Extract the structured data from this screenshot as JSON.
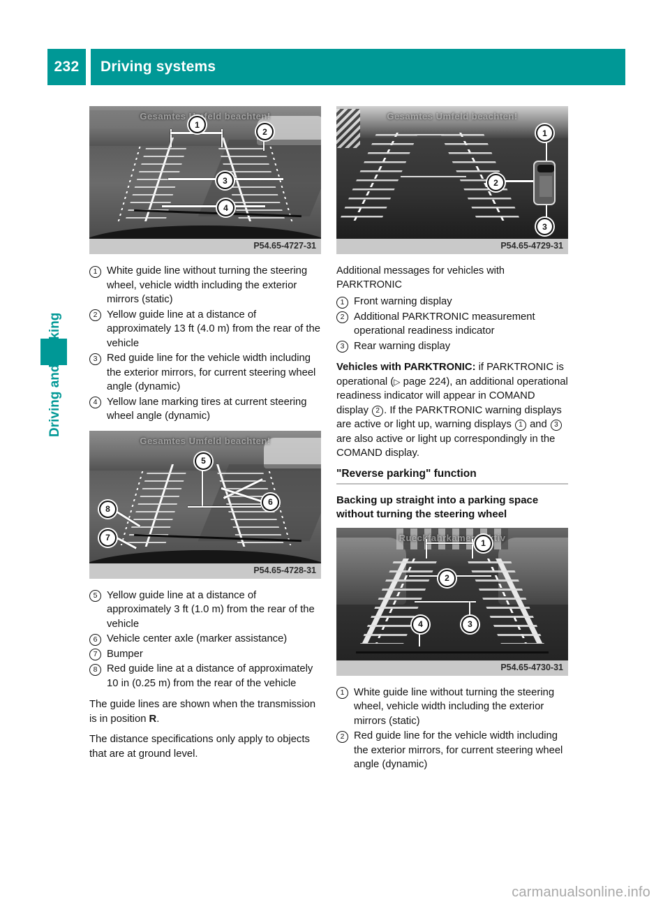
{
  "header": {
    "page_number": "232",
    "title": "Driving systems"
  },
  "sidebar": {
    "tab_label": "Driving and parking",
    "marker_color": "#009896"
  },
  "theme": {
    "accent": "#009896",
    "caption_bar": "#c9c9c9",
    "rule": "#bdbdbd"
  },
  "left_column": {
    "figure_1": {
      "caption": "P54.65-4727-31",
      "osd_text": "Gesamtes Umfeld beachten!",
      "callouts": [
        "1",
        "2",
        "3",
        "4"
      ]
    },
    "list_1": [
      {
        "num": "1",
        "text": "White guide line without turning the steering wheel, vehicle width including the exterior mirrors (static)"
      },
      {
        "num": "2",
        "text": "Yellow guide line at a distance of approximately 13 ft (4.0 m) from the rear of the vehicle"
      },
      {
        "num": "3",
        "text": "Red guide line for the vehicle width including the exterior mirrors, for current steering wheel angle (dynamic)"
      },
      {
        "num": "4",
        "text": "Yellow lane marking tires at current steering wheel angle (dynamic)"
      }
    ],
    "figure_2": {
      "caption": "P54.65-4728-31",
      "osd_text": "Gesamtes Umfeld beachten!",
      "callouts": [
        "5",
        "6",
        "7",
        "8"
      ]
    },
    "list_2": [
      {
        "num": "5",
        "text": "Yellow guide line at a distance of approximately 3 ft (1.0 m) from the rear of the vehicle"
      },
      {
        "num": "6",
        "text": "Vehicle center axle (marker assistance)"
      },
      {
        "num": "7",
        "text": "Bumper"
      },
      {
        "num": "8",
        "text": "Red guide line at a distance of approximately 10 in (0.25 m) from the rear of the vehicle"
      }
    ],
    "para_1_a": "The guide lines are shown when the transmission is in position ",
    "para_1_bold": "R",
    "para_1_b": ".",
    "para_2": "The distance specifications only apply to objects that are at ground level."
  },
  "right_column": {
    "figure_3": {
      "caption": "P54.65-4729-31",
      "osd_text": "Gesamtes Umfeld beachten!",
      "callouts": [
        "1",
        "2",
        "3"
      ]
    },
    "intro": "Additional messages for vehicles with PARKTRONIC",
    "list_1": [
      {
        "num": "1",
        "text": "Front warning display"
      },
      {
        "num": "2",
        "text": "Additional PARKTRONIC measurement operational readiness indicator"
      },
      {
        "num": "3",
        "text": "Rear warning display"
      }
    ],
    "parktronic_para": {
      "bold_lead": "Vehicles with PARKTRONIC:",
      "t1": " if PARKTRONIC is operational (",
      "ref_arrow": "▷",
      "t2": " page 224), an additional operational readiness indicator will appear in COMAND display ",
      "n1": "2",
      "t3": ". If the PARKTRONIC warning displays are active or light up, warning displays ",
      "n2": "1",
      "t4": " and ",
      "n3": "3",
      "t5": " are also active or light up correspondingly in the COMAND display."
    },
    "section_heading": "\"Reverse parking\" function",
    "sub_heading": "Backing up straight into a parking space without turning the steering wheel",
    "figure_4": {
      "caption": "P54.65-4730-31",
      "osd_text": "Rueckfahrkamera aktiv",
      "callouts": [
        "1",
        "2",
        "3",
        "4"
      ]
    },
    "list_2": [
      {
        "num": "1",
        "text": "White guide line without turning the steering wheel, vehicle width including the exterior mirrors (static)"
      },
      {
        "num": "2",
        "text": "Red guide line for the vehicle width including the exterior mirrors, for current steering wheel angle (dynamic)"
      }
    ]
  },
  "footer": {
    "watermark": "carmanualsonline.info"
  }
}
